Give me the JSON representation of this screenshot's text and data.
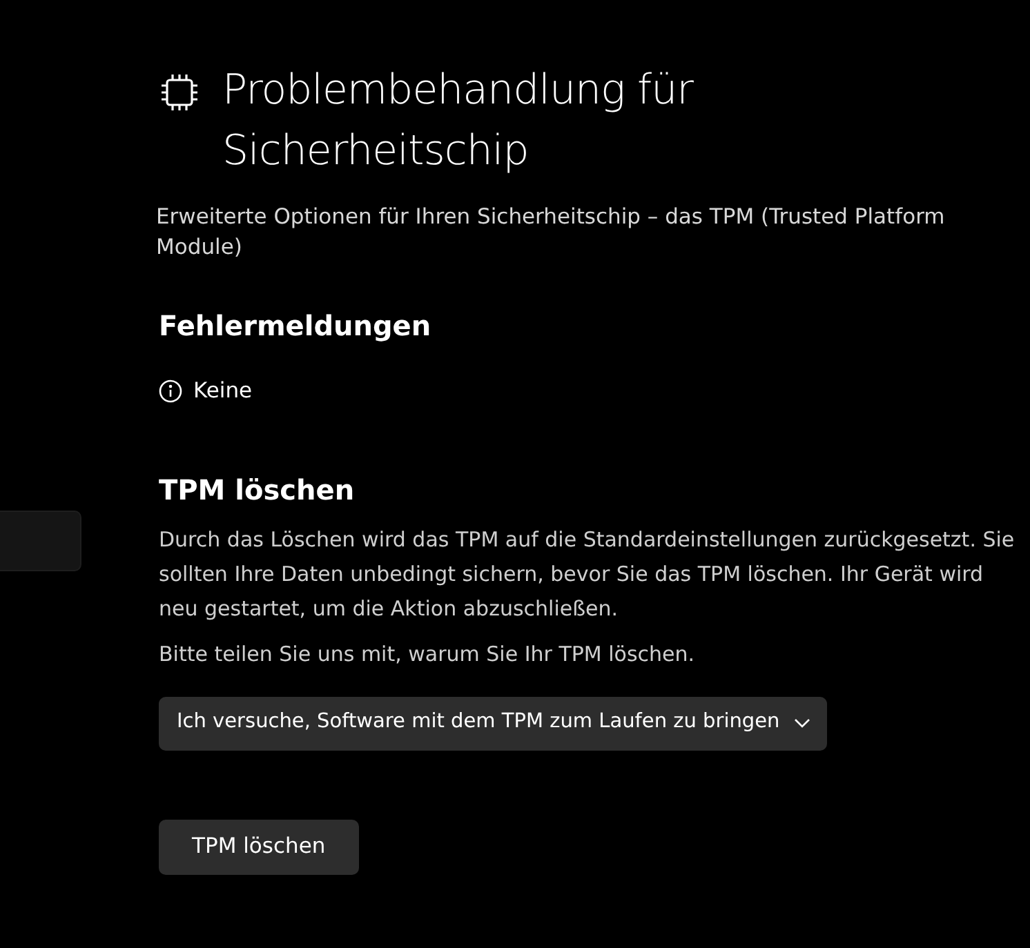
{
  "page": {
    "title": "Problembehandlung für Sicherheitschip",
    "subtitle": "Erweiterte Optionen für Ihren Sicherheitschip – das TPM (Trusted Platform Module)"
  },
  "sidebar": {
    "items": [
      {
        "selected": false
      }
    ]
  },
  "errors": {
    "heading": "Fehlermeldungen",
    "status": "Keine"
  },
  "clear_tpm": {
    "heading": "TPM löschen",
    "description": "Durch das Löschen wird das TPM auf die Standardeinstellungen zurückgesetzt. Sie sollten Ihre Daten unbedingt sichern, bevor Sie das TPM löschen. Ihr Gerät wird neu gestartet, um die Aktion abzuschließen.",
    "prompt": "Bitte teilen Sie uns mit, warum Sie Ihr TPM löschen.",
    "reason_dropdown": {
      "value": "Ich versuche, Software mit dem TPM zum Laufen zu bringen"
    },
    "button": {
      "label": "TPM löschen",
      "disabled": false
    }
  }
}
